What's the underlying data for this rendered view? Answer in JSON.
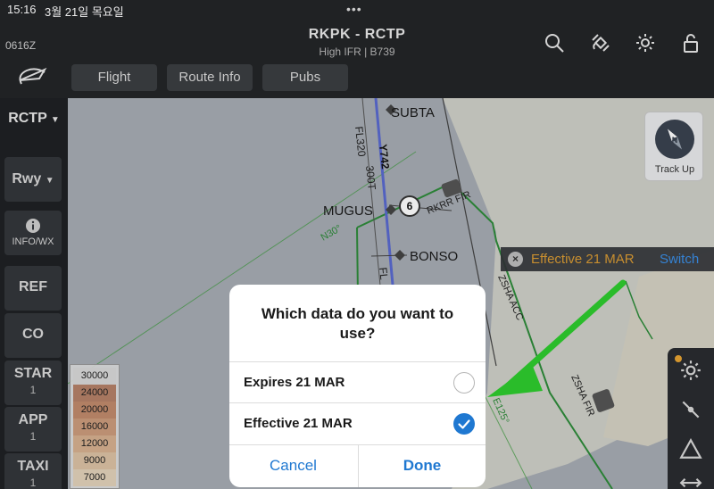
{
  "status_bar": {
    "time": "15:16",
    "date": "3월 21일 목요일",
    "dots": "•••"
  },
  "header": {
    "utc": "0616Z",
    "route_title": "RKPK - RCTP",
    "route_subtitle": "High IFR | B739",
    "tabs": [
      {
        "label": "Flight"
      },
      {
        "label": "Route Info"
      },
      {
        "label": "Pubs"
      }
    ],
    "icons": [
      "search-icon",
      "satellite-icon",
      "gear-icon",
      "lock-icon",
      "app-logo-icon"
    ]
  },
  "sidebar": {
    "airport": "RCTP",
    "runway": "Rwy",
    "info_label": "INFO/WX",
    "items": [
      {
        "label": "REF",
        "count": ""
      },
      {
        "label": "CO",
        "count": ""
      },
      {
        "label": "STAR",
        "count": "1"
      },
      {
        "label": "APP",
        "count": "1"
      },
      {
        "label": "TAXI",
        "count": "1"
      }
    ]
  },
  "map": {
    "labels": {
      "subta": "SUBTA",
      "mugus": "MUGUS",
      "bonso": "BONSO",
      "fl320": "FL320",
      "t300": "300T",
      "y742": "Y742",
      "fl_partial": "FL",
      "waypoint_num": "6",
      "rkrr_fir": "RKRR FIR",
      "n30": "N30°",
      "zsha_acc": "ZSHA ACC",
      "zsha_fir": "ZSHA FIR",
      "e125": "E125°"
    },
    "track_up": "Track Up",
    "compass_letter": "N",
    "effective_banner": {
      "text": "Effective 21 MAR",
      "action": "Switch"
    },
    "altitude_scale": [
      "30000",
      "24000",
      "20000",
      "16000",
      "12000",
      "9000",
      "7000"
    ]
  },
  "dialog": {
    "title": "Which data do you want to use?",
    "options": [
      {
        "label": "Expires 21 MAR",
        "selected": false
      },
      {
        "label": "Effective 21 MAR",
        "selected": true
      }
    ],
    "cancel": "Cancel",
    "done": "Done"
  },
  "colors": {
    "accent_blue": "#1f78d1",
    "warning_orange": "#d99b34",
    "arrow_green": "#2ecc2e",
    "map_green": "#2e8b3a"
  }
}
